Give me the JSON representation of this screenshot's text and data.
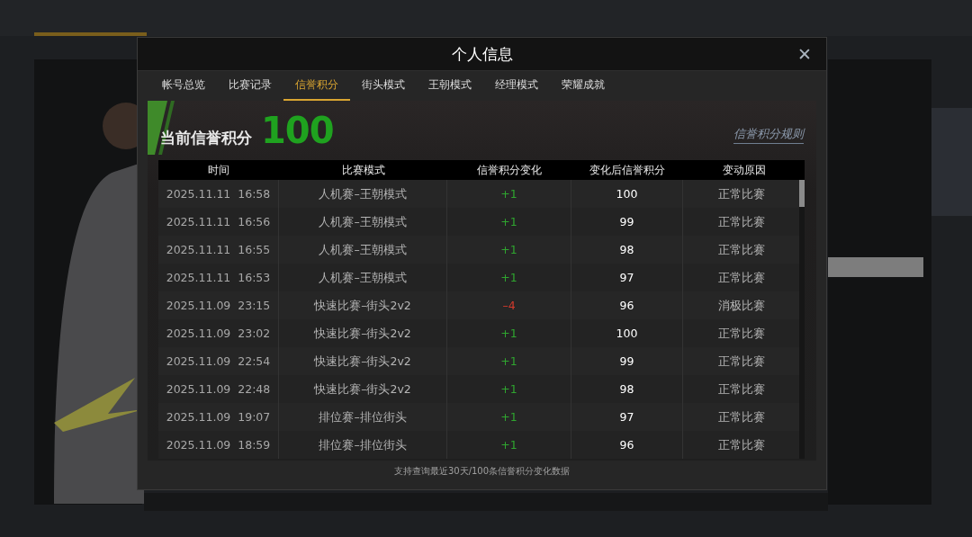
{
  "dialog": {
    "title": "个人信息",
    "close": "✕"
  },
  "tabs": [
    {
      "label": "帐号总览",
      "selected": false
    },
    {
      "label": "比赛记录",
      "selected": false
    },
    {
      "label": "信誉积分",
      "selected": true
    },
    {
      "label": "街头模式",
      "selected": false
    },
    {
      "label": "王朝模式",
      "selected": false
    },
    {
      "label": "经理模式",
      "selected": false
    },
    {
      "label": "荣耀成就",
      "selected": false
    }
  ],
  "credit": {
    "label": "当前信誉积分",
    "value": "100",
    "rules_link": "信誉积分规则"
  },
  "table": {
    "columns": [
      "时间",
      "比赛模式",
      "信誉积分变化",
      "变化后信誉积分",
      "变动原因"
    ],
    "rows": [
      {
        "time": "2025.11.11  16:58",
        "mode": "人机赛–王朝模式",
        "change": "+1",
        "color": "#2fa52f",
        "score": "100",
        "reason": "正常比赛"
      },
      {
        "time": "2025.11.11  16:56",
        "mode": "人机赛–王朝模式",
        "change": "+1",
        "color": "#2fa52f",
        "score": "99",
        "reason": "正常比赛"
      },
      {
        "time": "2025.11.11  16:55",
        "mode": "人机赛–王朝模式",
        "change": "+1",
        "color": "#2fa52f",
        "score": "98",
        "reason": "正常比赛"
      },
      {
        "time": "2025.11.11  16:53",
        "mode": "人机赛–王朝模式",
        "change": "+1",
        "color": "#2fa52f",
        "score": "97",
        "reason": "正常比赛"
      },
      {
        "time": "2025.11.09  23:15",
        "mode": "快速比赛–街头2v2",
        "change": "–4",
        "color": "#d33a2c",
        "score": "96",
        "reason": "消极比赛"
      },
      {
        "time": "2025.11.09  23:02",
        "mode": "快速比赛–街头2v2",
        "change": "+1",
        "color": "#2fa52f",
        "score": "100",
        "reason": "正常比赛"
      },
      {
        "time": "2025.11.09  22:54",
        "mode": "快速比赛–街头2v2",
        "change": "+1",
        "color": "#2fa52f",
        "score": "99",
        "reason": "正常比赛"
      },
      {
        "time": "2025.11.09  22:48",
        "mode": "快速比赛–街头2v2",
        "change": "+1",
        "color": "#2fa52f",
        "score": "98",
        "reason": "正常比赛"
      },
      {
        "time": "2025.11.09  19:07",
        "mode": "排位赛–排位街头",
        "change": "+1",
        "color": "#2fa52f",
        "score": "97",
        "reason": "正常比赛"
      },
      {
        "time": "2025.11.09  18:59",
        "mode": "排位赛–排位街头",
        "change": "+1",
        "color": "#2fa52f",
        "score": "96",
        "reason": "正常比赛"
      }
    ]
  },
  "footer": "支持查询最近30天/100条信誉积分变化数据"
}
